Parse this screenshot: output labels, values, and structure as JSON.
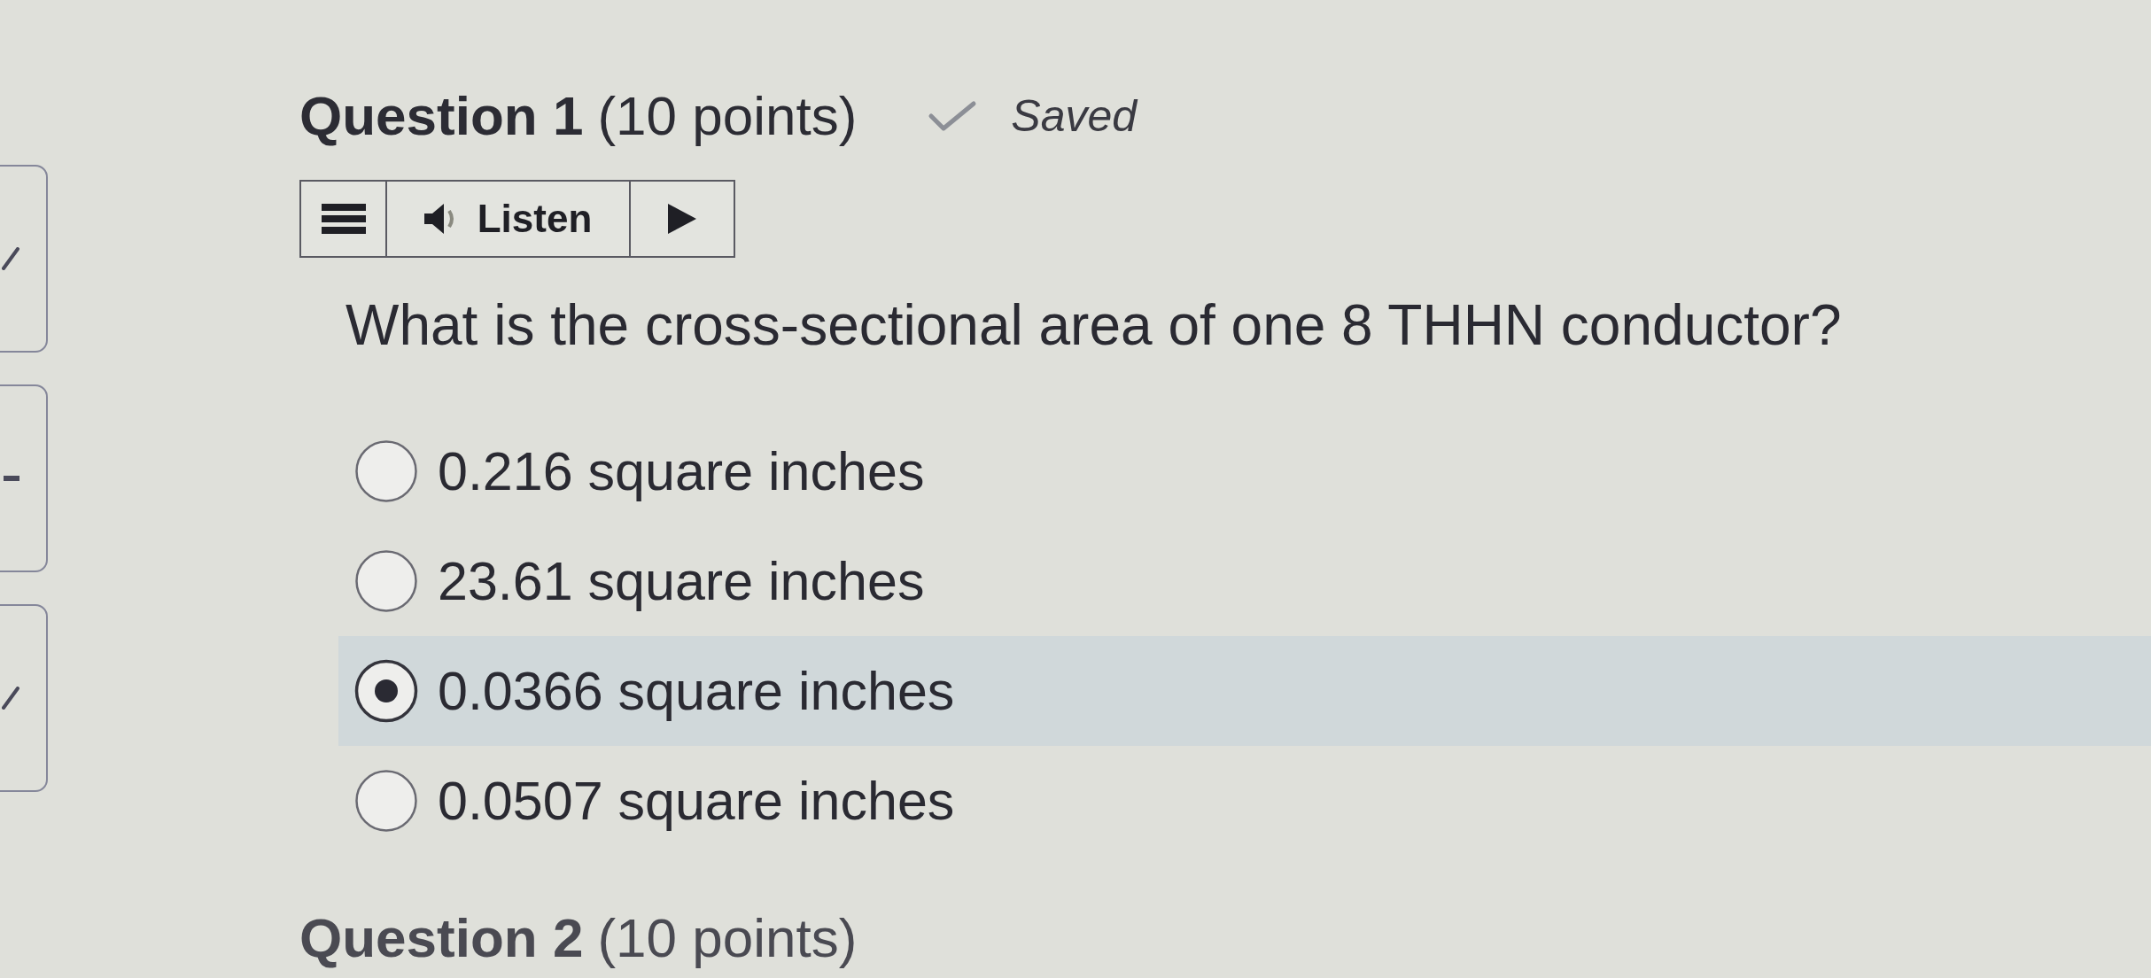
{
  "question_nav": [
    {
      "answered": true
    },
    {
      "answered": false
    },
    {
      "answered": true
    }
  ],
  "question": {
    "title": "Question 1",
    "points": "(10 points)",
    "status": "Saved"
  },
  "toolbar": {
    "listen_label": "Listen"
  },
  "prompt": "What is the cross-sectional area of one 8 THHN conductor?",
  "options": [
    {
      "label": "0.216 square inches",
      "selected": false
    },
    {
      "label": "23.61 square inches",
      "selected": false
    },
    {
      "label": "0.0366 square inches",
      "selected": true
    },
    {
      "label": "0.0507 square inches",
      "selected": false
    }
  ],
  "next_question": {
    "title": "Question 2",
    "points": "(10 points)"
  }
}
